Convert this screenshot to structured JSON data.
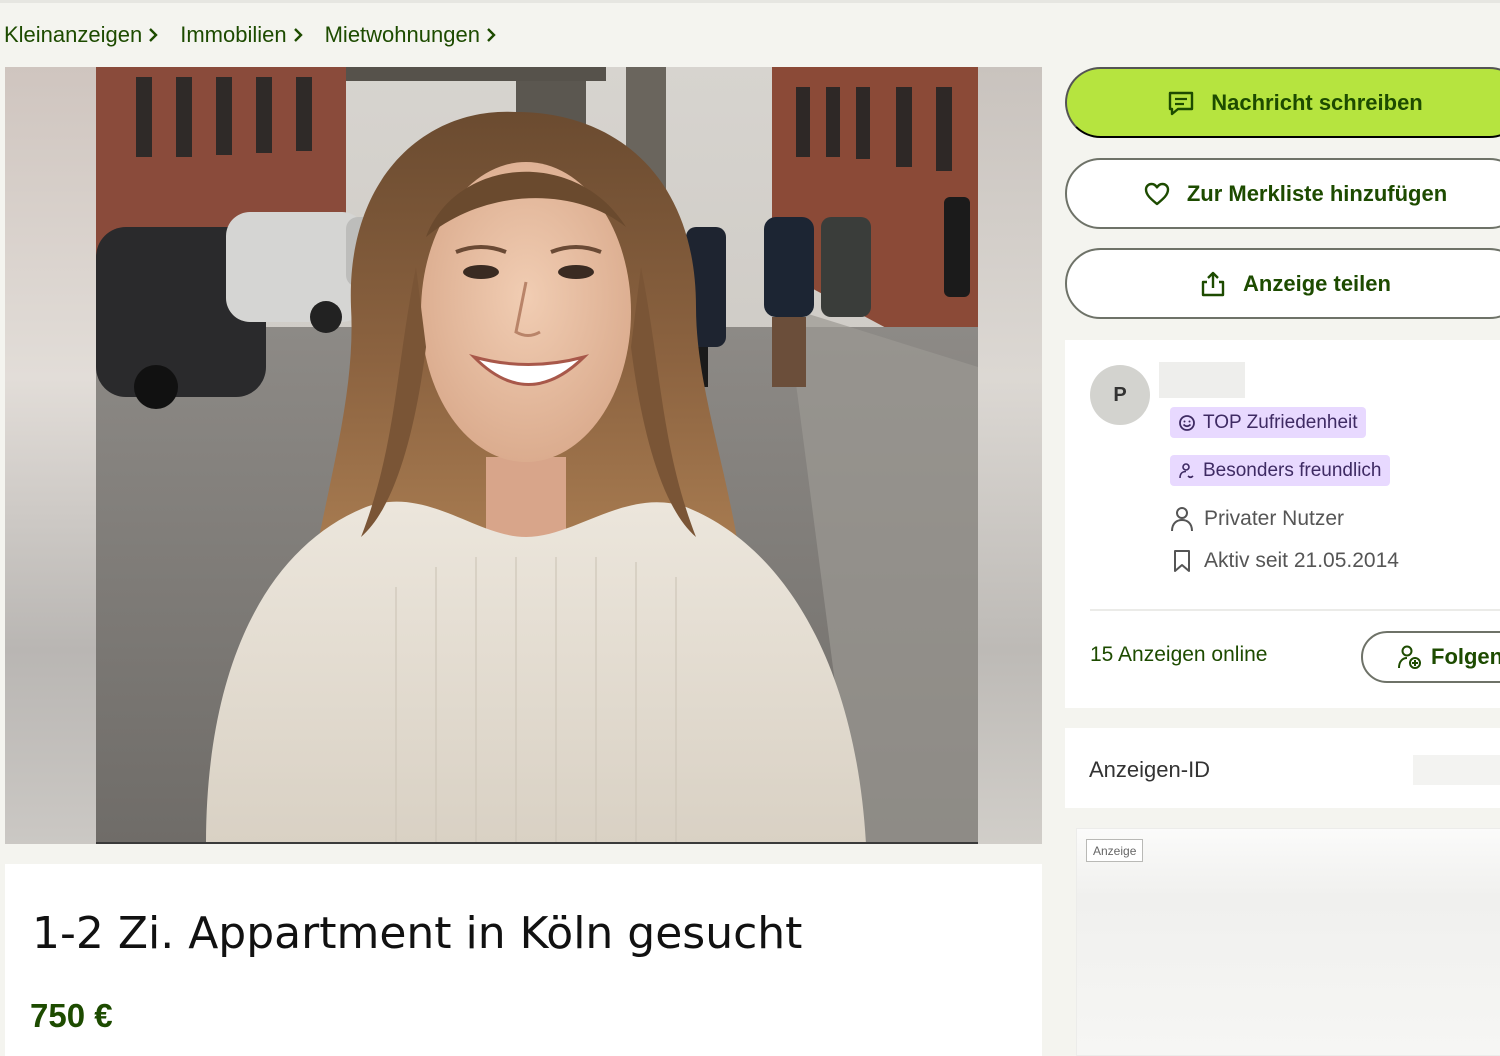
{
  "breadcrumb": [
    {
      "label": "Kleinanzeigen"
    },
    {
      "label": "Immobilien"
    },
    {
      "label": "Mietwohnungen"
    }
  ],
  "listing": {
    "title": "1-2 Zi. Appartment in Köln gesucht",
    "price": "750 €"
  },
  "actions": {
    "message_label": "Nachricht schreiben",
    "watchlist_label": "Zur Merkliste hinzufügen",
    "share_label": "Anzeige teilen"
  },
  "seller": {
    "avatar_letter": "P",
    "badges": [
      {
        "label": "TOP Zufriedenheit",
        "icon": "smiley-icon"
      },
      {
        "label": "Besonders freundlich",
        "icon": "friendly-user-icon"
      }
    ],
    "type": "Privater Nutzer",
    "active_since": "Aktiv seit 21.05.2014",
    "ads_online": "15 Anzeigen online",
    "follow_label": "Folgen"
  },
  "ad_id": {
    "label": "Anzeigen-ID"
  },
  "advert": {
    "tag": "Anzeige"
  },
  "colors": {
    "brand_green_dark": "#1d4b00",
    "brand_green_light": "#b6e43f",
    "badge_purple": "#e8d9ff",
    "page_background": "#f4f4ef"
  },
  "icons": {
    "message": "chat-bubble-icon",
    "watchlist": "heart-icon",
    "share": "share-upload-icon",
    "user": "user-icon",
    "since": "bookmark-icon",
    "follow": "user-plus-icon",
    "breadcrumb_separator": "chevron-right-icon"
  }
}
